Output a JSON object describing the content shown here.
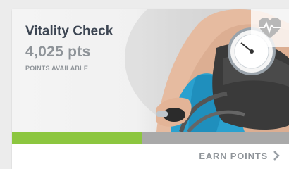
{
  "card": {
    "title": "Vitality Check",
    "points": "4,025 pts",
    "points_caption": "POINTS AVAILABLE",
    "badge_icon": "heart-pulse-icon",
    "image_subject": "blood-pressure-cuff-photo",
    "progress_fraction": 0.47,
    "progress_color": "#8cc63f",
    "track_color": "#a9a9a9",
    "earn_label": "EARN POINTS",
    "earn_icon": "chevron-right-icon"
  }
}
